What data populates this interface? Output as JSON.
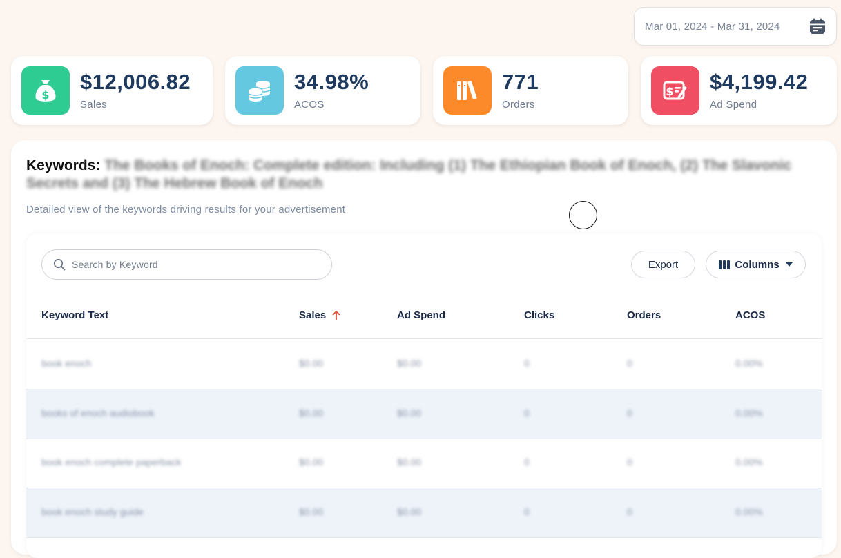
{
  "date_range": {
    "label": "Mar 01, 2024 - Mar 31, 2024",
    "icon": "calendar-icon"
  },
  "kpis": [
    {
      "value": "$12,006.82",
      "label": "Sales",
      "icon": "money-bag-icon",
      "color": "#2ecc92"
    },
    {
      "value": "34.98%",
      "label": "ACOS",
      "icon": "coins-stack-icon",
      "color": "#64c8e0"
    },
    {
      "value": "771",
      "label": "Orders",
      "icon": "books-icon",
      "color": "#fd8a2a"
    },
    {
      "value": "$4,199.42",
      "label": "Ad Spend",
      "icon": "bill-edit-icon",
      "color": "#f04e62"
    }
  ],
  "keywords": {
    "title_prefix": "Keywords:",
    "title_product": "The Books of Enoch: Complete edition: Including (1) The Ethiopian Book of Enoch, (2) The Slavonic Secrets and (3) The Hebrew Book of Enoch",
    "subtitle": "Detailed view of the keywords driving results for your advertisement"
  },
  "toolbar": {
    "search_placeholder": "Search by Keyword",
    "export_label": "Export",
    "columns_label": "Columns"
  },
  "table": {
    "headers": {
      "keyword": "Keyword Text",
      "sales": "Sales",
      "ad_spend": "Ad Spend",
      "clicks": "Clicks",
      "orders": "Orders",
      "acos": "ACOS"
    },
    "sort": {
      "column": "Sales",
      "direction": "ascending"
    },
    "rows": [
      {
        "keyword": "book enoch",
        "sales": "$0.00",
        "ad_spend": "$0.00",
        "clicks": "0",
        "orders": "0",
        "acos": "0.00%"
      },
      {
        "keyword": "books of enoch audiobook",
        "sales": "$0.00",
        "ad_spend": "$0.00",
        "clicks": "0",
        "orders": "0",
        "acos": "0.00%"
      },
      {
        "keyword": "book enoch complete paperback",
        "sales": "$0.00",
        "ad_spend": "$0.00",
        "clicks": "0",
        "orders": "0",
        "acos": "0.00%"
      },
      {
        "keyword": "book enoch study guide",
        "sales": "$0.00",
        "ad_spend": "$0.00",
        "clicks": "0",
        "orders": "0",
        "acos": "0.00%"
      }
    ]
  },
  "colors": {
    "background": "#fdf5ef",
    "accent_sort": "#e0523a",
    "row_alt": "#eef3fa"
  }
}
